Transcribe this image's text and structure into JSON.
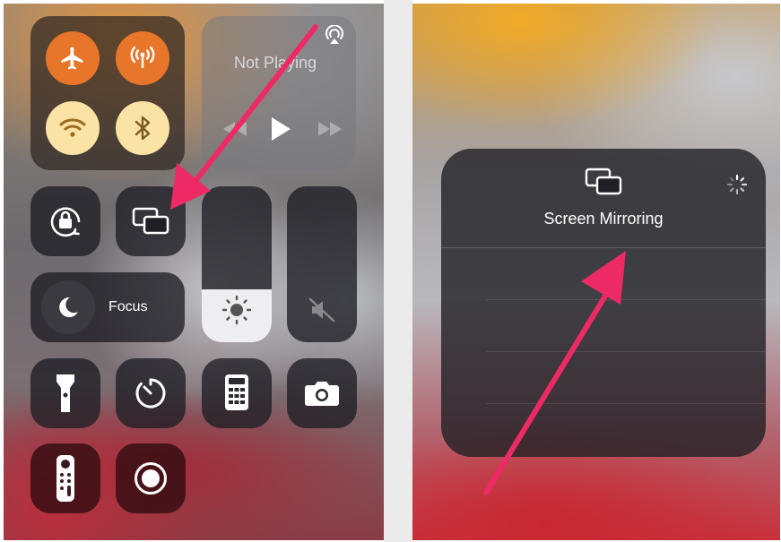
{
  "control_center": {
    "connectivity": {
      "airplane": "airplane-mode",
      "cellular": "cellular-data",
      "wifi": "wifi",
      "bluetooth": "bluetooth"
    },
    "now_playing": {
      "status": "Not Playing"
    },
    "focus": {
      "label": "Focus"
    }
  },
  "screen_mirroring": {
    "title": "Screen Mirroring"
  },
  "colors": {
    "accent_orange": "#e8762a",
    "wifi_yellow": "#fbe3a5",
    "arrow_pink": "#ee2a66",
    "module_dark": "#1e1e24"
  }
}
